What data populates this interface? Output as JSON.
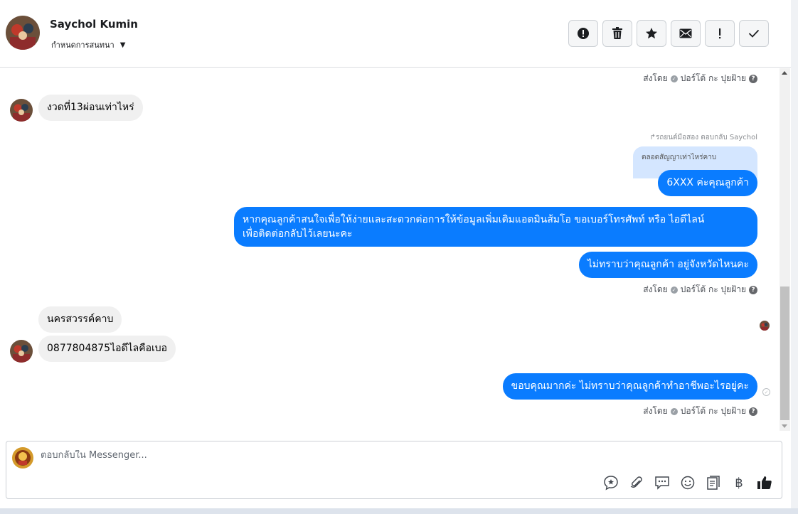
{
  "header": {
    "contact_name": "Saychol Kumin",
    "subtitle": "กำหนดการสนทนา"
  },
  "toolbar": {
    "buttons": [
      {
        "name": "report-button",
        "icon": "alert-circle-icon"
      },
      {
        "name": "delete-button",
        "icon": "trash-icon"
      },
      {
        "name": "star-button",
        "icon": "star-icon"
      },
      {
        "name": "mark-unread-button",
        "icon": "envelope-icon"
      },
      {
        "name": "important-button",
        "icon": "exclamation-icon"
      },
      {
        "name": "done-button",
        "icon": "check-icon"
      }
    ]
  },
  "sent_by": {
    "label": "ส่งโดย",
    "agent": "ปอร์โต้ กะ ปุยฝ้าย",
    "help": "?"
  },
  "messages": {
    "m1": "งวดที่13ผ่อนเท่าไหร่",
    "reply_note": "↱รถยนต์มือสอง ตอบกลับ Saychol",
    "quoted": "ตลอดสัญญาเท่าไหร่คาบ",
    "m2": "6XXX ค่ะคุณลูกค้า",
    "m3_line1": "หากคุณลูกค้าสนใจเพื่อให้ง่ายและสะดวกต่อการให้ข้อมูลเพิ่มเติมแอดมินส้มโอ ขอเบอร์โทรศัพท์ หรือ ไอดีไลน์",
    "m3_line2": "เพื่อติดต่อกลับไว้เลยนะคะ",
    "m4": "ไม่ทราบว่าคุณลูกค้า อยู่จังหวัดไหนคะ",
    "m5": "นครสวรรค์คาบ",
    "m6": "0877804875ไอดีไลคือเบอ",
    "m7": "ขอบคุณมากค่ะ  ไม่ทราบว่าคุณลูกค้าทำอาชีพอะไรอยู่คะ"
  },
  "composer": {
    "placeholder": "ตอบกลับใน Messenger...",
    "currency_symbol": "฿"
  },
  "colors": {
    "outgoing_bubble": "#0a7cff",
    "incoming_bubble": "#f0f0f0",
    "quoted_bubble": "#d4e6ff"
  }
}
